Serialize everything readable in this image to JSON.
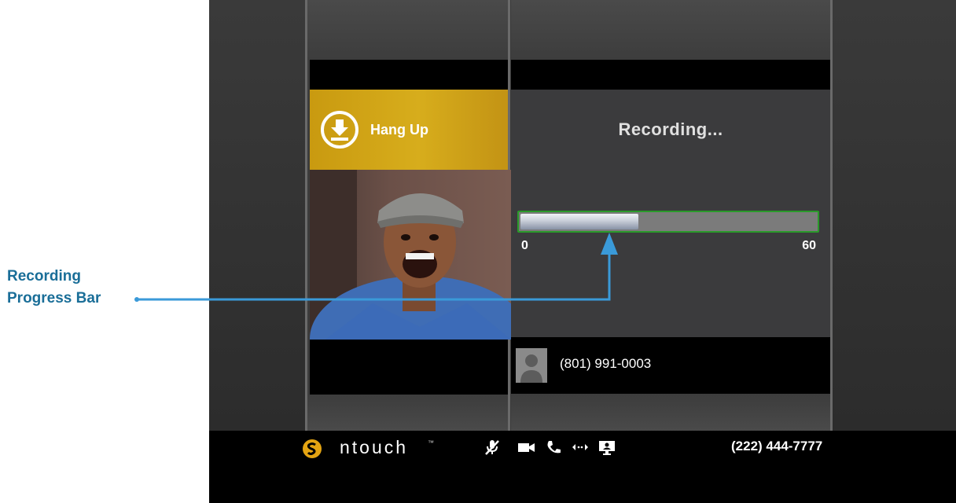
{
  "callout": {
    "label_line1": "Recording",
    "label_line2": "Progress Bar",
    "color": "#3a9ad9"
  },
  "call": {
    "hangup_label": "Hang Up",
    "hangup_color": "#d4a91b"
  },
  "recording": {
    "title": "Recording...",
    "progress_fraction": 0.4,
    "min_label": "0",
    "max_label": "60",
    "progress_border_color": "#2a9a2a"
  },
  "caller": {
    "number": "(801) 991-0003",
    "avatar_icon": "person-silhouette-icon"
  },
  "taskbar": {
    "brand": "ntouch",
    "trademark": "™",
    "logo_icon": "sorenson-s-logo-icon",
    "icons": [
      "mic-muted-icon",
      "video-camera-icon",
      "phone-icon",
      "transfer-arrows-icon",
      "screen-share-icon"
    ],
    "my_number": "(222) 444-7777"
  }
}
